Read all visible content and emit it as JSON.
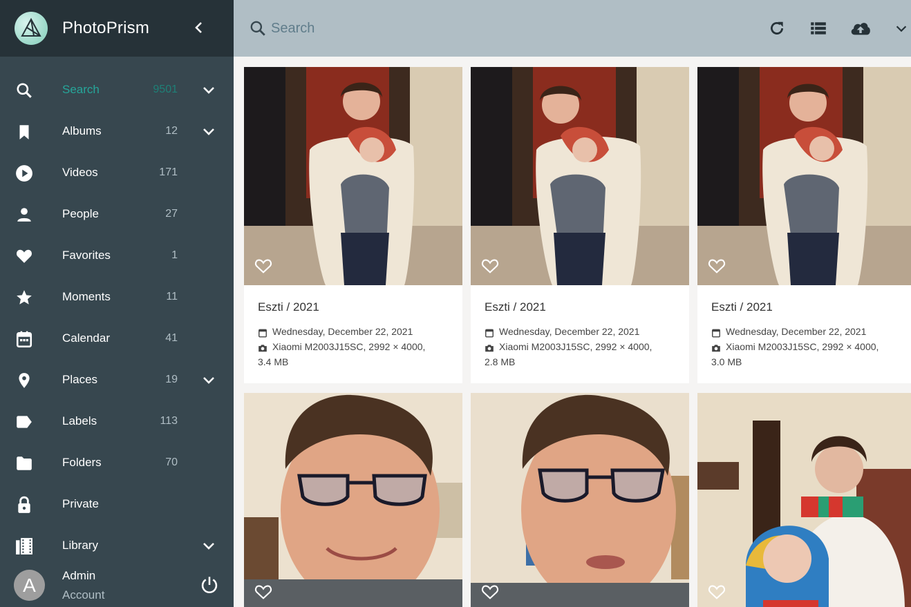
{
  "app": {
    "title": "PhotoPrism"
  },
  "nav": [
    {
      "label": "Search",
      "count": "9501",
      "icon": "search-icon",
      "chevron": true,
      "active": true
    },
    {
      "label": "Albums",
      "count": "12",
      "icon": "bookmark-icon",
      "chevron": true
    },
    {
      "label": "Videos",
      "count": "171",
      "icon": "play-circle-icon"
    },
    {
      "label": "People",
      "count": "27",
      "icon": "person-icon"
    },
    {
      "label": "Favorites",
      "count": "1",
      "icon": "heart-icon"
    },
    {
      "label": "Moments",
      "count": "11",
      "icon": "star-icon"
    },
    {
      "label": "Calendar",
      "count": "41",
      "icon": "calendar-icon"
    },
    {
      "label": "Places",
      "count": "19",
      "icon": "place-pin-icon",
      "chevron": true
    },
    {
      "label": "Labels",
      "count": "113",
      "icon": "label-tag-icon"
    },
    {
      "label": "Folders",
      "count": "70",
      "icon": "folder-icon"
    },
    {
      "label": "Private",
      "count": "",
      "icon": "lock-icon"
    },
    {
      "label": "Library",
      "count": "",
      "icon": "library-film-icon",
      "chevron": true
    }
  ],
  "account": {
    "initial": "A",
    "name": "Admin",
    "sub": "Account"
  },
  "search": {
    "placeholder": "Search"
  },
  "photos": [
    {
      "title": "Eszti / 2021",
      "date": "Wednesday, December 22, 2021",
      "camera": "Xiaomi M2003J15SC, 2992 × 4000,",
      "size": "3.4 MB"
    },
    {
      "title": "Eszti / 2021",
      "date": "Wednesday, December 22, 2021",
      "camera": "Xiaomi M2003J15SC, 2992 × 4000,",
      "size": "2.8 MB"
    },
    {
      "title": "Eszti / 2021",
      "date": "Wednesday, December 22, 2021",
      "camera": "Xiaomi M2003J15SC, 2992 × 4000,",
      "size": "3.0 MB"
    }
  ],
  "colors": {
    "sidebar": "#37474f",
    "brandbar": "#263238",
    "topbar": "#b0bec5",
    "accent": "#26a69a"
  }
}
